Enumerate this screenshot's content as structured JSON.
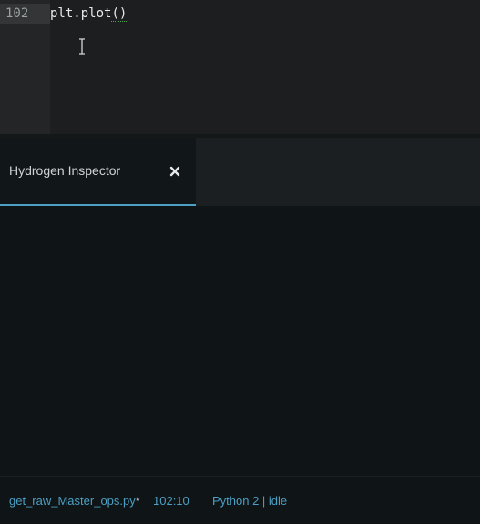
{
  "editor": {
    "line_number": "102",
    "code": {
      "object": "plt",
      "dot": ".",
      "method": "plot",
      "call": "()"
    }
  },
  "dock": {
    "tab_title": "Hydrogen Inspector",
    "close_glyph": "×"
  },
  "status_bar": {
    "file_name": "get_raw_Master_ops.py",
    "modified_marker": "*",
    "cursor_position": "102:10",
    "kernel_status": "Python 2 | idle"
  },
  "colors": {
    "accent": "#4d9fc4",
    "editor_background": "#1c1e1f",
    "panel_background": "#0f1416",
    "underline": "#4ea84e"
  },
  "icons": {
    "close": "close-icon",
    "cursor": "text-cursor-icon"
  }
}
